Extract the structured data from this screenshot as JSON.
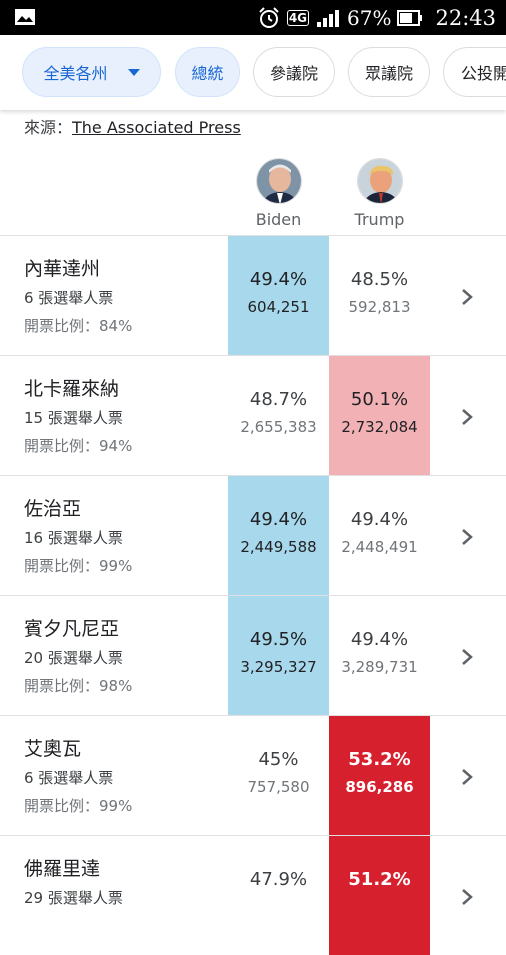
{
  "status_bar": {
    "network": "4G",
    "battery_percent": "67%",
    "time": "22:43"
  },
  "filters": {
    "region": "全美各州",
    "tabs": [
      "總統",
      "參議院",
      "眾議院",
      "公投開"
    ],
    "active_tab": "總統"
  },
  "source": {
    "label": "來源：",
    "name": "The Associated Press"
  },
  "candidates": [
    {
      "name": "Biden",
      "party_color": "#a8d8ec"
    },
    {
      "name": "Trump",
      "party_color": "#d6202e"
    }
  ],
  "states": [
    {
      "name": "內華達州",
      "electoral_votes": "6 張選舉人票",
      "reported": "開票比例：84%",
      "biden_pct": "49.4%",
      "biden_votes": "604,251",
      "trump_pct": "48.5%",
      "trump_votes": "592,813",
      "leader": "biden",
      "called": false
    },
    {
      "name": "北卡羅來納",
      "electoral_votes": "15 張選舉人票",
      "reported": "開票比例：94%",
      "biden_pct": "48.7%",
      "biden_votes": "2,655,383",
      "trump_pct": "50.1%",
      "trump_votes": "2,732,084",
      "leader": "trump",
      "called": false
    },
    {
      "name": "佐治亞",
      "electoral_votes": "16 張選舉人票",
      "reported": "開票比例：99%",
      "biden_pct": "49.4%",
      "biden_votes": "2,449,588",
      "trump_pct": "49.4%",
      "trump_votes": "2,448,491",
      "leader": "biden",
      "called": false
    },
    {
      "name": "賓夕凡尼亞",
      "electoral_votes": "20 張選舉人票",
      "reported": "開票比例：98%",
      "biden_pct": "49.5%",
      "biden_votes": "3,295,327",
      "trump_pct": "49.4%",
      "trump_votes": "3,289,731",
      "leader": "biden",
      "called": false
    },
    {
      "name": "艾奧瓦",
      "electoral_votes": "6 張選舉人票",
      "reported": "開票比例：99%",
      "biden_pct": "45%",
      "biden_votes": "757,580",
      "trump_pct": "53.2%",
      "trump_votes": "896,286",
      "leader": "trump",
      "called": true
    },
    {
      "name": "佛羅里達",
      "electoral_votes": "29 張選舉人票",
      "reported": "",
      "biden_pct": "47.9%",
      "biden_votes": "",
      "trump_pct": "51.2%",
      "trump_votes": "",
      "leader": "trump",
      "called": true
    }
  ]
}
